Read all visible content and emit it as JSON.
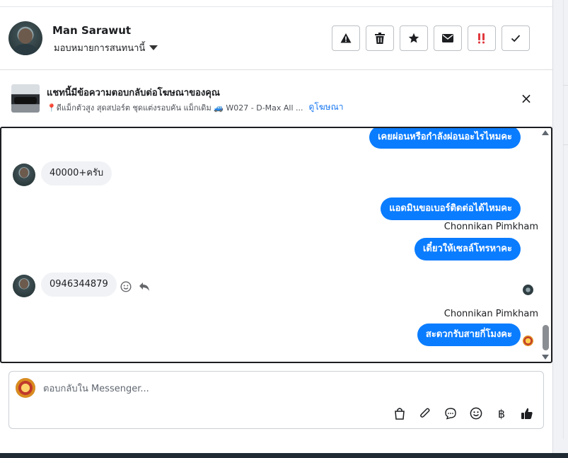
{
  "header": {
    "user_name": "Man Sarawut",
    "assign_label": "มอบหมายการสนทนานี้",
    "toolbar": [
      {
        "name": "report-spam-button",
        "icon": "warning-icon"
      },
      {
        "name": "delete-button",
        "icon": "trash-icon"
      },
      {
        "name": "star-button",
        "icon": "star-icon"
      },
      {
        "name": "mark-unread-button",
        "icon": "mail-icon"
      },
      {
        "name": "flag-important-button",
        "icon": "double-exclamation-icon"
      },
      {
        "name": "mark-done-button",
        "icon": "check-icon"
      }
    ]
  },
  "ad_banner": {
    "title": "แชทนี้มีข้อความตอบกลับต่อโฆษณาของคุณ",
    "pin_icon": "📍",
    "subtitle": "ดีแม็กตัวสูง สุดสปอร์ต ชุดแต่งรอบคัน แม็กเดิม 🚙 W027 - D-Max All ...",
    "link_text": "ดูโฆษณา",
    "close_icon": "×"
  },
  "messages": [
    {
      "direction": "out",
      "text": "เคยผ่อนหรือกำลังผ่อนอะไรไหมคะ"
    },
    {
      "direction": "in",
      "text": "40000+ครับ"
    },
    {
      "direction": "out",
      "text": "แอดมินขอเบอร์ติดต่อได้ไหมคะ"
    },
    {
      "direction": "out",
      "sender": "Chonnikan Pimkham",
      "text": "เดี๋ยวให้เซลล์โทรหาคะ"
    },
    {
      "direction": "in",
      "text": "0946344879"
    },
    {
      "direction": "out",
      "sender": "Chonnikan Pimkham",
      "text": "สะดวกรับสายกี่โมงคะ"
    }
  ],
  "composer": {
    "placeholder": "ตอบกลับใน Messenger...",
    "tools": [
      "bag-icon",
      "paperclip-icon",
      "chat-bubble-icon",
      "emoji-icon",
      "baht-icon",
      "thumbs-up-icon"
    ],
    "baht_symbol": "฿"
  },
  "colors": {
    "outgoing_bubble": "#0a7cff",
    "incoming_bubble": "#f0f2f5",
    "link": "#1877f2"
  }
}
